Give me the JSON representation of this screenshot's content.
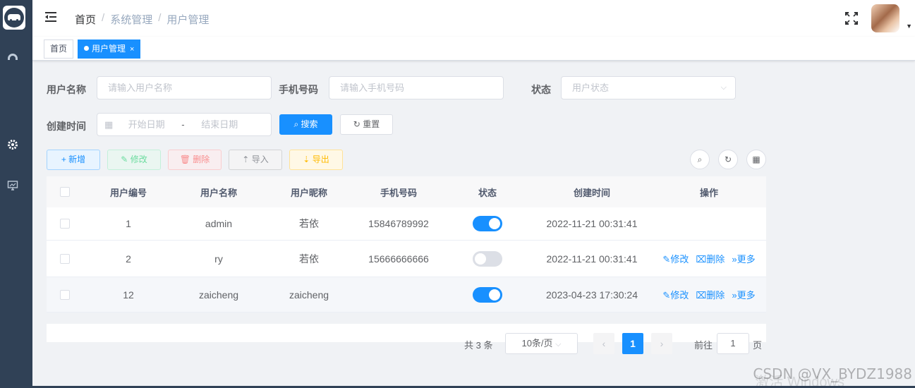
{
  "breadcrumb": [
    "首页",
    "系统管理",
    "用户管理"
  ],
  "tags": [
    {
      "label": "首页"
    },
    {
      "label": "用户管理",
      "close": "×"
    }
  ],
  "search": {
    "username_label": "用户名称",
    "username_placeholder": "请输入用户名称",
    "phone_label": "手机号码",
    "phone_placeholder": "请输入手机号码",
    "status_label": "状态",
    "status_placeholder": "用户状态",
    "created_label": "创建时间",
    "start_placeholder": "开始日期",
    "range_sep": "-",
    "end_placeholder": "结束日期",
    "search_btn": "搜索",
    "reset_btn": "重置"
  },
  "toolbar": {
    "add": "新增",
    "edit": "修改",
    "delete": "删除",
    "import": "导入",
    "export": "导出"
  },
  "table": {
    "columns": [
      "用户编号",
      "用户名称",
      "用户昵称",
      "手机号码",
      "状态",
      "创建时间",
      "操作"
    ],
    "rows": [
      {
        "id": "1",
        "username": "admin",
        "nickname": "若依",
        "phone": "15846789992",
        "status": true,
        "created": "2022-11-21 00:31:41",
        "actions": []
      },
      {
        "id": "2",
        "username": "ry",
        "nickname": "若依",
        "phone": "15666666666",
        "status": false,
        "created": "2022-11-21 00:31:41",
        "actions": [
          "修改",
          "删除",
          "更多"
        ]
      },
      {
        "id": "12",
        "username": "zaicheng",
        "nickname": "zaicheng",
        "phone": "",
        "status": true,
        "created": "2023-04-23 17:30:24",
        "actions": [
          "修改",
          "删除",
          "更多"
        ]
      }
    ]
  },
  "pagination": {
    "total_text": "共 3 条",
    "page_size": "10条/页",
    "current_page": "1",
    "goto_label": "前往",
    "goto_value": "1",
    "goto_suffix": "页"
  },
  "watermark": "CSDN @VX_BYDZ1988",
  "watermark2": "激活 Windows",
  "colors": {
    "primary": "#1890ff",
    "sidebar": "#304156"
  }
}
